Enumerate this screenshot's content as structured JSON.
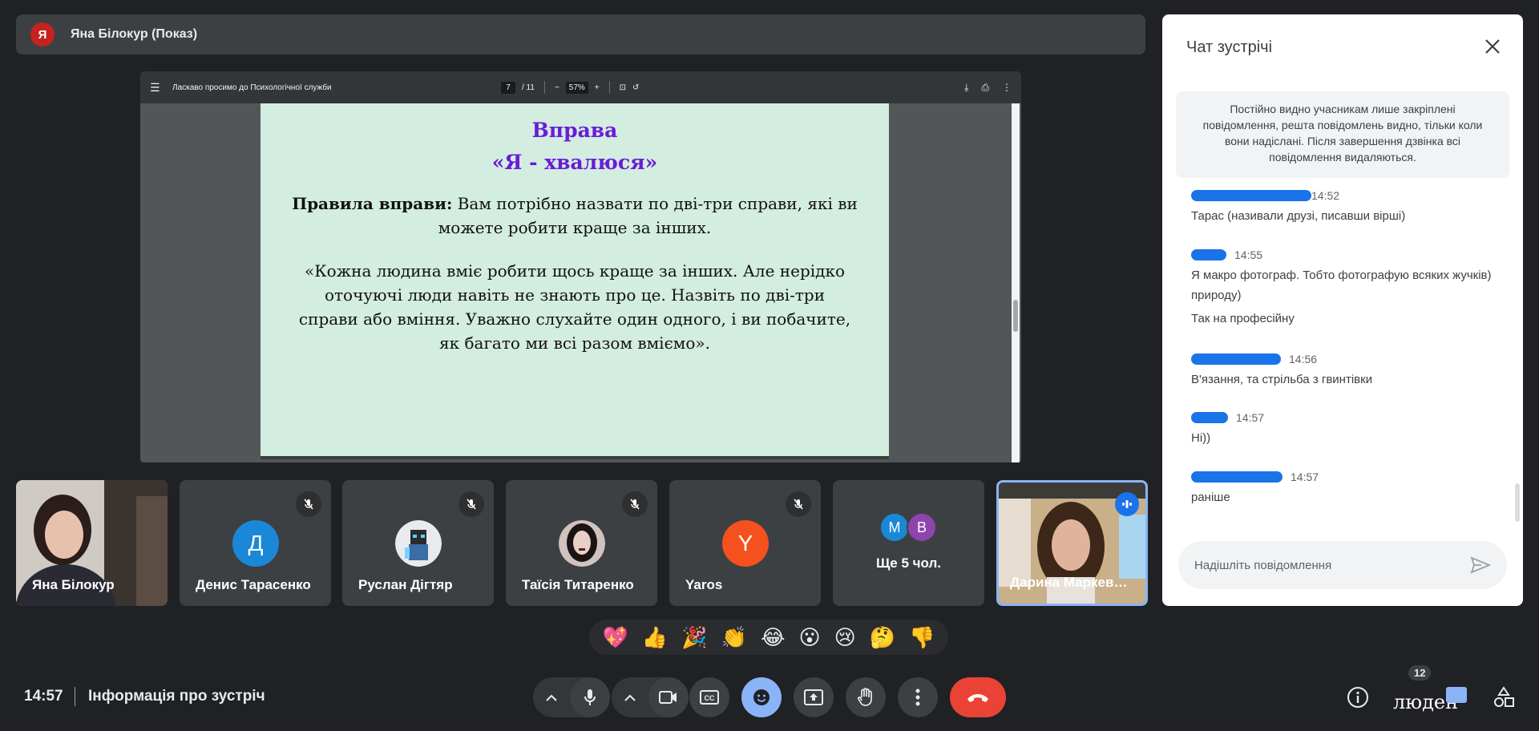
{
  "presenter": {
    "avatar_letter": "Я",
    "name": "Яна Білокур (Показ)"
  },
  "pdf": {
    "title": "Ласкаво просимо до Психологічної служби",
    "page_current": "7",
    "page_total": "/ 11",
    "zoom": "57%",
    "slide": {
      "title_line1": "Вправа",
      "title_line2": "«Я - хвалюся»",
      "rules_label": "Правила вправи:",
      "rules_text": " Вам потрібно назвати по дві-три справи, які ви можете робити краще за інших.",
      "quote": "«Кожна людина вміє робити щось краще за інших. Але нерідко оточуючі люди навіть не знають про це. Назвіть по дві-три справи або вміння. Уважно слухайте один одного, і ви побачите, як багато ми всі разом вміємо»."
    }
  },
  "participants": [
    {
      "name": "Яна Білокур",
      "type": "video"
    },
    {
      "name": "Денис Тарасенко",
      "avatar_letter": "Д",
      "avatar_color": "#1a88d6",
      "muted": true
    },
    {
      "name": "Руслан Дігтяр",
      "type": "image-avatar",
      "muted": true
    },
    {
      "name": "Таїсія Титаренко",
      "type": "image-avatar",
      "muted": true
    },
    {
      "name": "Yaros",
      "avatar_letter": "Y",
      "avatar_color": "#f4511e",
      "muted": true
    },
    {
      "name": "Ще 5 чол.",
      "mini": [
        {
          "letter": "M",
          "color": "#1a88d6"
        },
        {
          "letter": "В",
          "color": "#8e44ad"
        }
      ]
    },
    {
      "name": "Дарина Маркев…",
      "type": "video",
      "speaking": true
    }
  ],
  "reactions": [
    "💖",
    "👍",
    "🎉",
    "👏",
    "😂",
    "😮",
    "😢",
    "🤔",
    "👎"
  ],
  "bottom_bar": {
    "time": "14:57",
    "meeting_info": "Інформація про зустріч",
    "people_count": "12",
    "people_label": "люден"
  },
  "chat": {
    "title": "Чат зустрічі",
    "note": "Постійно видно учасникам лише закріплені повідомлення, решта повідомлень видно, тільки коли вони надіслані. Після завершення дзвінка всі повідомлення видаляються.",
    "messages": [
      {
        "time": "14:52",
        "lines": [
          "Тарас (називали друзі, писавши вірші)"
        ]
      },
      {
        "time": "14:55",
        "lines": [
          "Я макро фотограф. Тобто фотографую всяких жучків) природу)",
          "Так на професійну"
        ]
      },
      {
        "time": "14:56",
        "lines": [
          "В'язання, та стрільба з гвинтівки"
        ]
      },
      {
        "time": "14:57",
        "lines": [
          "Ні))"
        ]
      },
      {
        "time": "14:57",
        "lines": [
          "раніше"
        ]
      }
    ],
    "input_placeholder": "Надішліть повідомлення"
  }
}
